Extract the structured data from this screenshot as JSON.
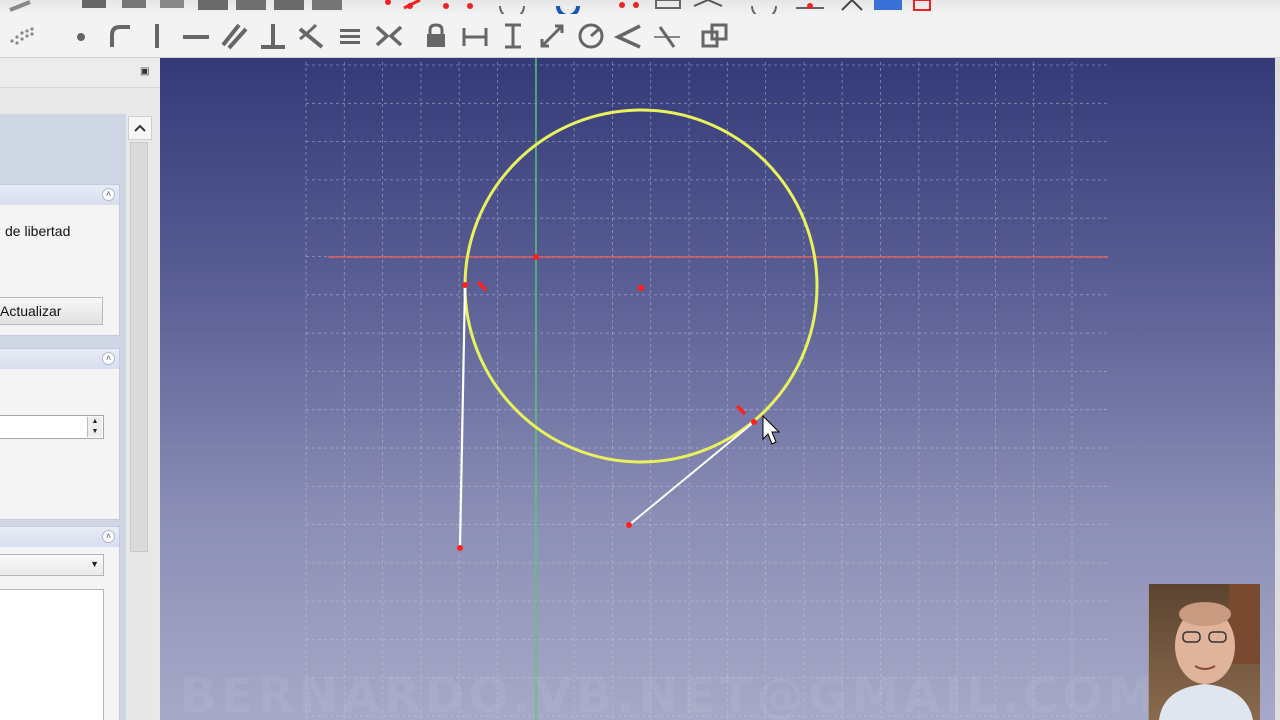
{
  "toolbar_top": {
    "icons": [
      "part-icon",
      "cube-icon",
      "cube-icon",
      "cube-icon",
      "box-icon",
      "box-icon",
      "box-icon",
      "box-icon",
      "sketch-point-icon",
      "sketch-red-icon",
      "sketch-red-icon",
      "sketch-circle-icon",
      "sketch-blue-icon",
      "sketch-red-icon",
      "sketch-red-icon",
      "sketch-layers-icon",
      "sketch-circle-icon",
      "sketch-red-icon",
      "sketch-tool-icon",
      "cube-blue-icon",
      "close-red-icon"
    ]
  },
  "toolbar_sketcher": {
    "buttons": [
      {
        "name": "point-grid-icon"
      },
      {
        "name": "point-icon"
      },
      {
        "name": "fillet-icon"
      },
      {
        "name": "vertical-constraint-icon"
      },
      {
        "name": "horizontal-constraint-icon"
      },
      {
        "name": "parallel-constraint-icon"
      },
      {
        "name": "perpendicular-constraint-icon"
      },
      {
        "name": "tangent-constraint-icon"
      },
      {
        "name": "equal-constraint-icon"
      },
      {
        "name": "symmetric-constraint-icon"
      },
      {
        "name": "lock-constraint-icon"
      },
      {
        "name": "horizontal-distance-icon"
      },
      {
        "name": "vertical-distance-icon"
      },
      {
        "name": "distance-constraint-icon"
      },
      {
        "name": "radius-constraint-icon"
      },
      {
        "name": "angle-constraint-icon"
      },
      {
        "name": "snell-law-icon"
      },
      {
        "name": "toggle-construction-icon"
      }
    ]
  },
  "left_panel": {
    "solver_text": "de libertad",
    "update_button": "Actualizar"
  },
  "viewport": {
    "watermark": "BERNARDO.VB.NET@GMAIL.COM"
  },
  "colors": {
    "circle": "#e8f25a",
    "h_axis": "#e06060",
    "v_axis": "#4fcf6a",
    "point": "#ff2020",
    "line": "#ffffff",
    "grid": "#c8cbe0"
  }
}
